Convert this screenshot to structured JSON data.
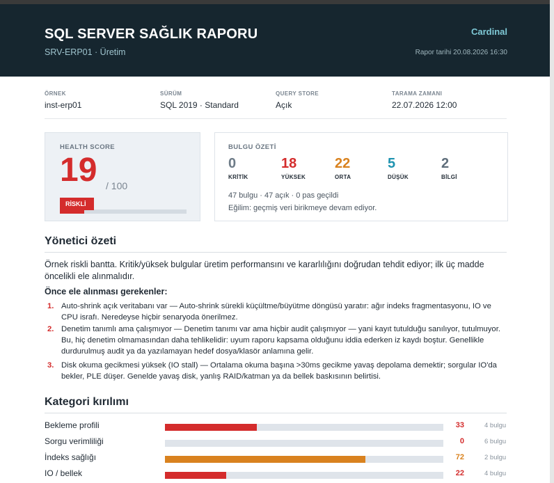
{
  "header": {
    "title": "SQL SERVER SAĞLIK RAPORU",
    "subtitle": "SRV-ERP01 · Üretim",
    "brand": "Cardinal",
    "report_date": "Rapor tarihi 20.08.2026 16:30"
  },
  "meta": [
    {
      "label": "ÖRNEK",
      "value": "inst-erp01"
    },
    {
      "label": "SÜRÜM",
      "value": "SQL 2019 · Standard"
    },
    {
      "label": "QUERY STORE",
      "value": "Açık"
    },
    {
      "label": "TARAMA ZAMANI",
      "value": "22.07.2026 12:00"
    }
  ],
  "health": {
    "label": "HEALTH SCORE",
    "score": "19",
    "max": "/ 100",
    "badge": "RİSKLİ",
    "fraction": 0.19,
    "color": "#d42c2c"
  },
  "findings": {
    "label": "BULGU ÖZETİ",
    "items": [
      {
        "count": "0",
        "label": "KRİTİK",
        "color": "#6e7c88"
      },
      {
        "count": "18",
        "label": "YÜKSEK",
        "color": "#d42c2c"
      },
      {
        "count": "22",
        "label": "ORTA",
        "color": "#d9821f"
      },
      {
        "count": "5",
        "label": "DÜŞÜK",
        "color": "#1e93b0"
      },
      {
        "count": "2",
        "label": "BİLGİ",
        "color": "#5f6e7b"
      }
    ],
    "summary": "47 bulgu · 47 açık · 0 pas geçildi",
    "trend": "Eğilim: geçmiş veri birikmeye devam ediyor."
  },
  "executive": {
    "title": "Yönetici özeti",
    "paragraph": "Örnek riskli bantta. Kritik/yüksek bulgular üretim performansını ve kararlılığını doğrudan tehdit ediyor; ilk üç madde öncelikli ele alınmalıdır.",
    "must_title": "Önce ele alınması gerekenler:",
    "items": [
      {
        "num": "1.",
        "text": "Auto-shrink açık veritabanı var — Auto-shrink sürekli küçültme/büyütme döngüsü yaratır: ağır indeks fragmentasyonu, IO ve CPU israfı. Neredeyse hiçbir senaryoda önerilmez."
      },
      {
        "num": "2.",
        "text": "Denetim tanımlı ama çalışmıyor — Denetim tanımı var ama hiçbir audit çalışmıyor — yani kayıt tutulduğu sanılıyor, tutulmuyor. Bu, hiç denetim olmamasından daha tehlikelidir: uyum raporu kapsama olduğunu iddia ederken iz kaydı boştur. Genellikle durdurulmuş audit ya da yazılamayan hedef dosya/klasör anlamına gelir."
      },
      {
        "num": "3.",
        "text": "Disk okuma gecikmesi yüksek (IO stall) — Ortalama okuma başına >30ms gecikme yavaş depolama demektir; sorgular IO'da bekler, PLE düşer. Genelde yavaş disk, yanlış RAID/katman ya da bellek baskısının belirtisi."
      }
    ]
  },
  "categories": {
    "title": "Kategori kırılımı",
    "rows": [
      {
        "name": "Bekleme profili",
        "score": "33",
        "value": 33,
        "color": "#d42c2c",
        "count": "4 bulgu"
      },
      {
        "name": "Sorgu verimliliği",
        "score": "0",
        "value": 0,
        "color": "#d42c2c",
        "count": "6 bulgu"
      },
      {
        "name": "İndeks sağlığı",
        "score": "72",
        "value": 72,
        "color": "#d9821f",
        "count": "2 bulgu"
      },
      {
        "name": "IO / bellek",
        "score": "22",
        "value": 22,
        "color": "#d42c2c",
        "count": "4 bulgu"
      }
    ]
  }
}
